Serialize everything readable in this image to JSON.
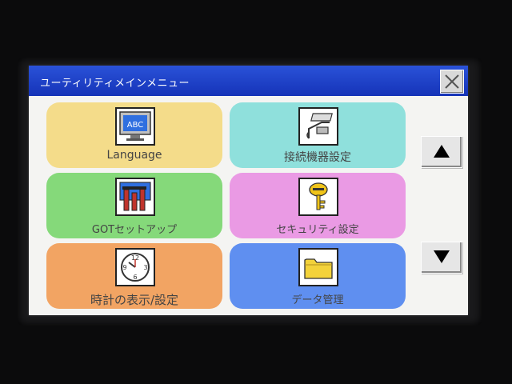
{
  "window": {
    "title": "ユーティリティメインメニュー"
  },
  "tiles": [
    {
      "label": "Language",
      "color": "#f4dc8a",
      "icon": "abc-monitor-icon"
    },
    {
      "label": "接続機器設定",
      "color": "#8fe0dc",
      "icon": "connector-plug-icon"
    },
    {
      "label": "GOTセットアップ",
      "color": "#85d97a",
      "icon": "tools-setup-icon"
    },
    {
      "label": "セキュリティ設定",
      "color": "#ea9ae4",
      "icon": "key-icon"
    },
    {
      "label": "時計の表示/設定",
      "color": "#f2a463",
      "icon": "clock-icon"
    },
    {
      "label": "データ管理",
      "color": "#5f8ff0",
      "icon": "folder-icon"
    }
  ],
  "nav": {
    "up": "up-arrow-icon",
    "down": "down-arrow-icon"
  }
}
